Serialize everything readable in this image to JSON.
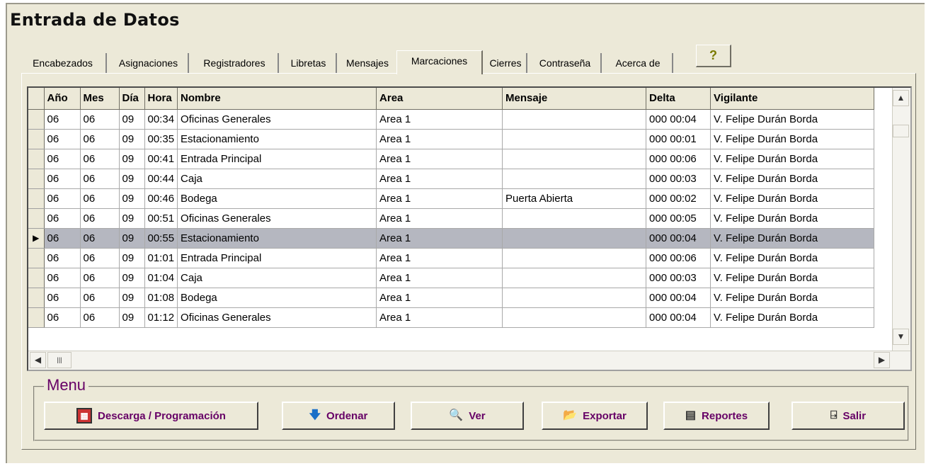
{
  "window": {
    "title": "Entrada de Datos"
  },
  "tabs": [
    {
      "label": "Encabezados"
    },
    {
      "label": "Asignaciones"
    },
    {
      "label": "Registradores"
    },
    {
      "label": "Libretas"
    },
    {
      "label": "Mensajes"
    },
    {
      "label": "Marcaciones",
      "active": true
    },
    {
      "label": "Cierres"
    },
    {
      "label": "Contraseña"
    },
    {
      "label": "Acerca de"
    }
  ],
  "help_button": {
    "glyph": "?"
  },
  "grid": {
    "columns": [
      "Año",
      "Mes",
      "Día",
      "Hora",
      "Nombre",
      "Area",
      "Mensaje",
      "Delta",
      "Vigilante"
    ],
    "selected_row": 6,
    "rows": [
      [
        "06",
        "06",
        "09",
        "00:34",
        "Oficinas Generales",
        "Area 1",
        "",
        "000 00:04",
        "V. Felipe Durán Borda"
      ],
      [
        "06",
        "06",
        "09",
        "00:35",
        "Estacionamiento",
        "Area 1",
        "",
        "000 00:01",
        "V. Felipe Durán Borda"
      ],
      [
        "06",
        "06",
        "09",
        "00:41",
        "Entrada Principal",
        "Area 1",
        "",
        "000 00:06",
        "V. Felipe Durán Borda"
      ],
      [
        "06",
        "06",
        "09",
        "00:44",
        "Caja",
        "Area 1",
        "",
        "000 00:03",
        "V. Felipe Durán Borda"
      ],
      [
        "06",
        "06",
        "09",
        "00:46",
        "Bodega",
        "Area 1",
        "Puerta Abierta",
        "000 00:02",
        "V. Felipe Durán Borda"
      ],
      [
        "06",
        "06",
        "09",
        "00:51",
        "Oficinas Generales",
        "Area 1",
        "",
        "000 00:05",
        "V. Felipe Durán Borda"
      ],
      [
        "06",
        "06",
        "09",
        "00:55",
        "Estacionamiento",
        "Area 1",
        "",
        "000 00:04",
        "V. Felipe Durán Borda"
      ],
      [
        "06",
        "06",
        "09",
        "01:01",
        "Entrada Principal",
        "Area 1",
        "",
        "000 00:06",
        "V. Felipe Durán Borda"
      ],
      [
        "06",
        "06",
        "09",
        "01:04",
        "Caja",
        "Area 1",
        "",
        "000 00:03",
        "V. Felipe Durán Borda"
      ],
      [
        "06",
        "06",
        "09",
        "01:08",
        "Bodega",
        "Area 1",
        "",
        "000 00:04",
        "V. Felipe Durán Borda"
      ],
      [
        "06",
        "06",
        "09",
        "01:12",
        "Oficinas Generales",
        "Area 1",
        "",
        "000 00:04",
        "V. Felipe Durán Borda"
      ]
    ]
  },
  "menu": {
    "legend": "Menu",
    "buttons": [
      {
        "label": "Descarga / Programación",
        "icon": "download-program-icon"
      },
      {
        "label": "Ordenar",
        "icon": "sort-down-arrow-icon"
      },
      {
        "label": "Ver",
        "icon": "magnifier-icon"
      },
      {
        "label": "Exportar",
        "icon": "export-folder-icon"
      },
      {
        "label": "Reportes",
        "icon": "report-icon"
      },
      {
        "label": "Salir",
        "icon": "exit-door-icon"
      }
    ]
  },
  "colors": {
    "accent": "#660066",
    "face": "#ece9d8",
    "selected_row": "#b5b7c0"
  }
}
